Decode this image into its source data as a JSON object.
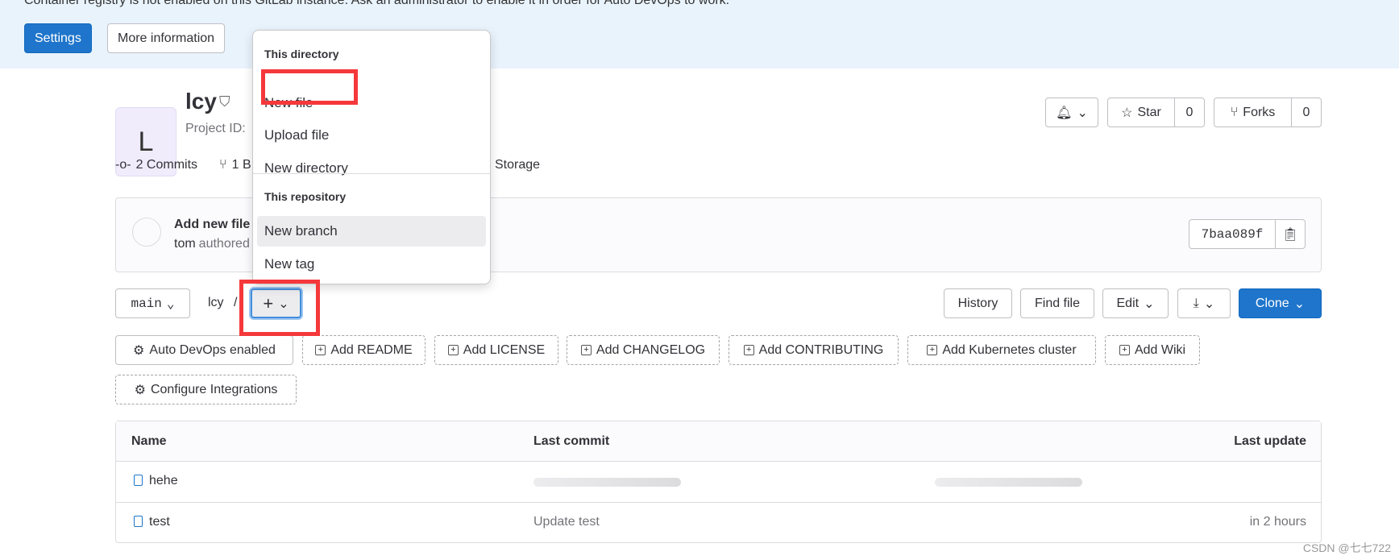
{
  "banner": {
    "text": "Container registry is not enabled on this GitLab instance. Ask an administrator to enable it in order for Auto DevOps to work.",
    "settings": "Settings",
    "more_info": "More information"
  },
  "dropdown": {
    "section1": "This directory",
    "new_file": "New file",
    "upload_file": "Upload file",
    "new_directory": "New directory",
    "section2": "This repository",
    "new_branch": "New branch",
    "new_tag": "New tag"
  },
  "project": {
    "avatar_letter": "L",
    "name": "lcy",
    "project_id_label": "Project ID:",
    "commits": "2 Commits",
    "branches": "1 B",
    "storage": "Storage"
  },
  "actions": {
    "star": "Star",
    "star_count": "0",
    "forks": "Forks",
    "forks_count": "0"
  },
  "commit": {
    "title": "Add new file",
    "author": "tom",
    "authored": "authored",
    "sha": "7baa089f"
  },
  "toolbar": {
    "branch": "main",
    "path": "lcy",
    "sep": "/",
    "history": "History",
    "find_file": "Find file",
    "edit": "Edit",
    "clone": "Clone"
  },
  "quick": [
    "Auto DevOps enabled",
    "Add README",
    "Add LICENSE",
    "Add CHANGELOG",
    "Add CONTRIBUTING",
    "Add Kubernetes cluster",
    "Add Wiki",
    "Configure Integrations"
  ],
  "table": {
    "headers": [
      "Name",
      "Last commit",
      "Last update"
    ],
    "rows": [
      {
        "name": "hehe",
        "commit": "",
        "update": ""
      },
      {
        "name": "test",
        "commit": "Update test",
        "update": "in 2 hours"
      }
    ]
  },
  "watermark": "CSDN @七七722",
  "colors": {
    "primary": "#1f75cb",
    "highlight": "#f5383b"
  }
}
